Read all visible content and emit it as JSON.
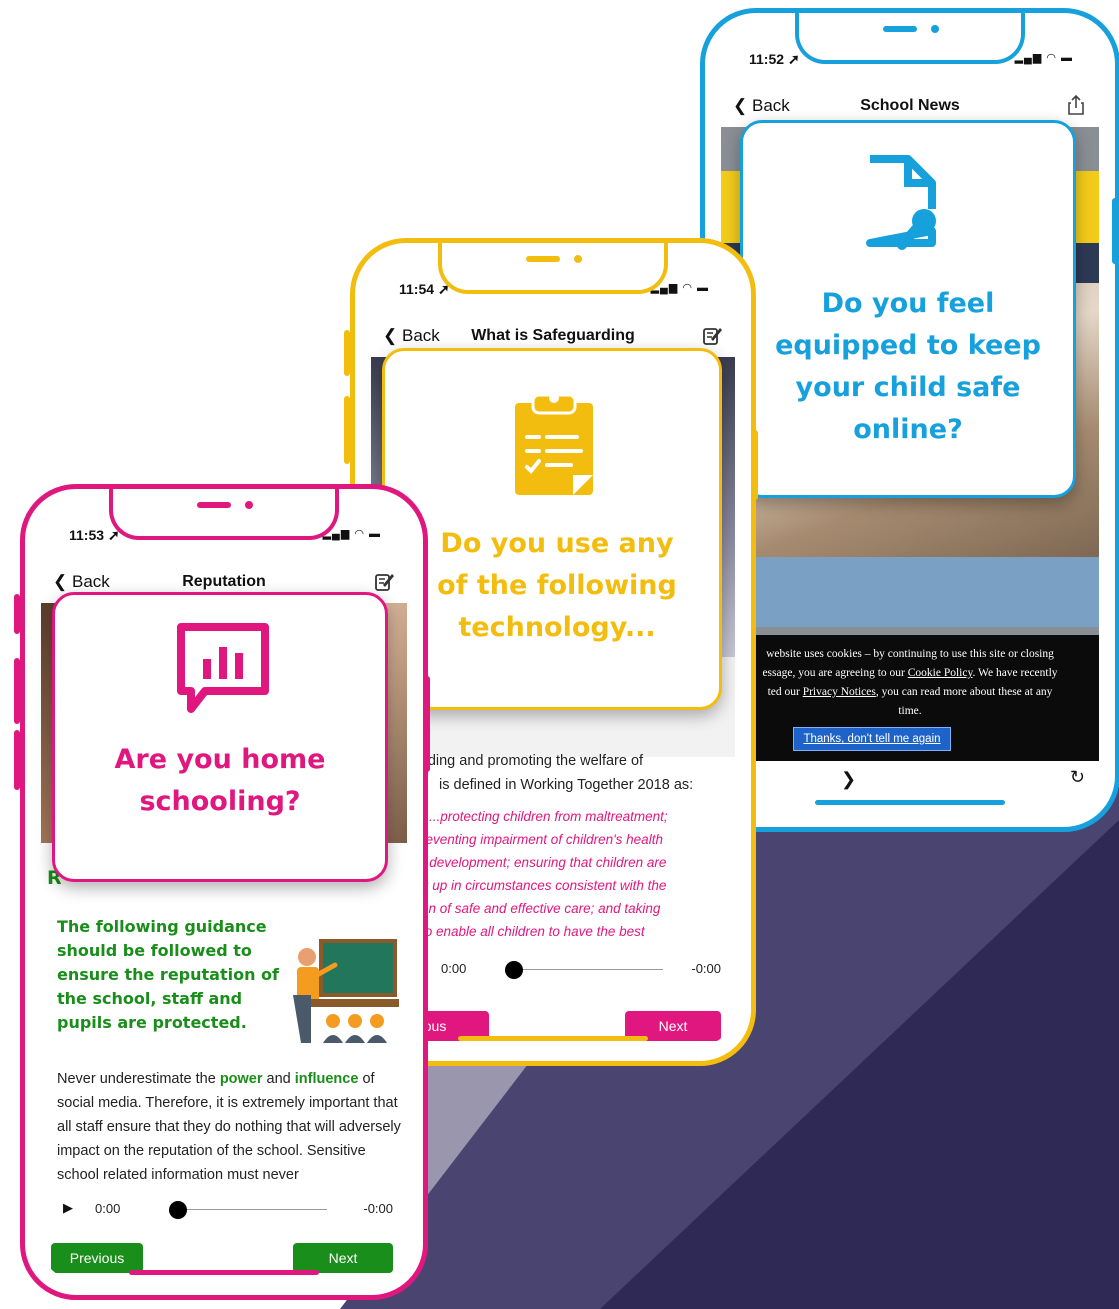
{
  "colors": {
    "pink": "#e0177f",
    "yellow": "#f3bd10",
    "blue": "#16a0dc",
    "green": "#1a8e1a",
    "navy": "#2f2a55"
  },
  "phone_pink": {
    "time": "11:53",
    "back": "Back",
    "title": "Reputation",
    "popup_icon": "bar-chart-speech-icon",
    "popup_text": "Are you home schooling?",
    "heading_fragment": "R",
    "guidance": "The following guidance should be followed to ensure the reputation of the school, staff and pupils are protected.",
    "body": {
      "p1": "Never underestimate the ",
      "power": "power",
      "p2": " and ",
      "influence": "influence",
      "p3": " of social media. Therefore, it is extremely important that all staff ensure that they do nothing that will adversely impact on the reputation of the school. Sensitive school related information must never"
    },
    "audio_start": "0:00",
    "audio_end": "-0:00",
    "prev": "Previous",
    "next": "Next"
  },
  "phone_yellow": {
    "time": "11:54",
    "back": "Back",
    "title": "What is Safeguarding",
    "popup_icon": "clipboard-checklist-icon",
    "popup_text": "Do you use any of the following technology...",
    "body_line1": "rding and promoting the welfare of",
    "body_line2": "is defined in Working Together 2018 as:",
    "quote": [
      "...protecting children from maltreatment;",
      "reventing impairment of children's health",
      "r development; ensuring that children are",
      "g up in circumstances consistent with the",
      "on of safe and effective care; and taking",
      "to enable all children to have the best"
    ],
    "audio_start": "0:00",
    "audio_end": "-0:00",
    "prev": "vious",
    "next": "Next"
  },
  "phone_blue": {
    "time": "11:52",
    "back": "Back",
    "title": "School News",
    "popup_icon": "document-search-icon",
    "popup_text": "Do you feel equipped to keep your child safe online?",
    "cookie": {
      "l1": " website uses cookies – by continuing to use this site or closing",
      "l2a": "essage, you are agreeing to our ",
      "cookie_policy": "Cookie Policy",
      "l2b": ". We have recently",
      "l3a": "ted our ",
      "privacy_notices": "Privacy Notices",
      "l3b": ", you can read more about these at any",
      "l4": "time.",
      "button": "Thanks, don't tell me again"
    }
  }
}
